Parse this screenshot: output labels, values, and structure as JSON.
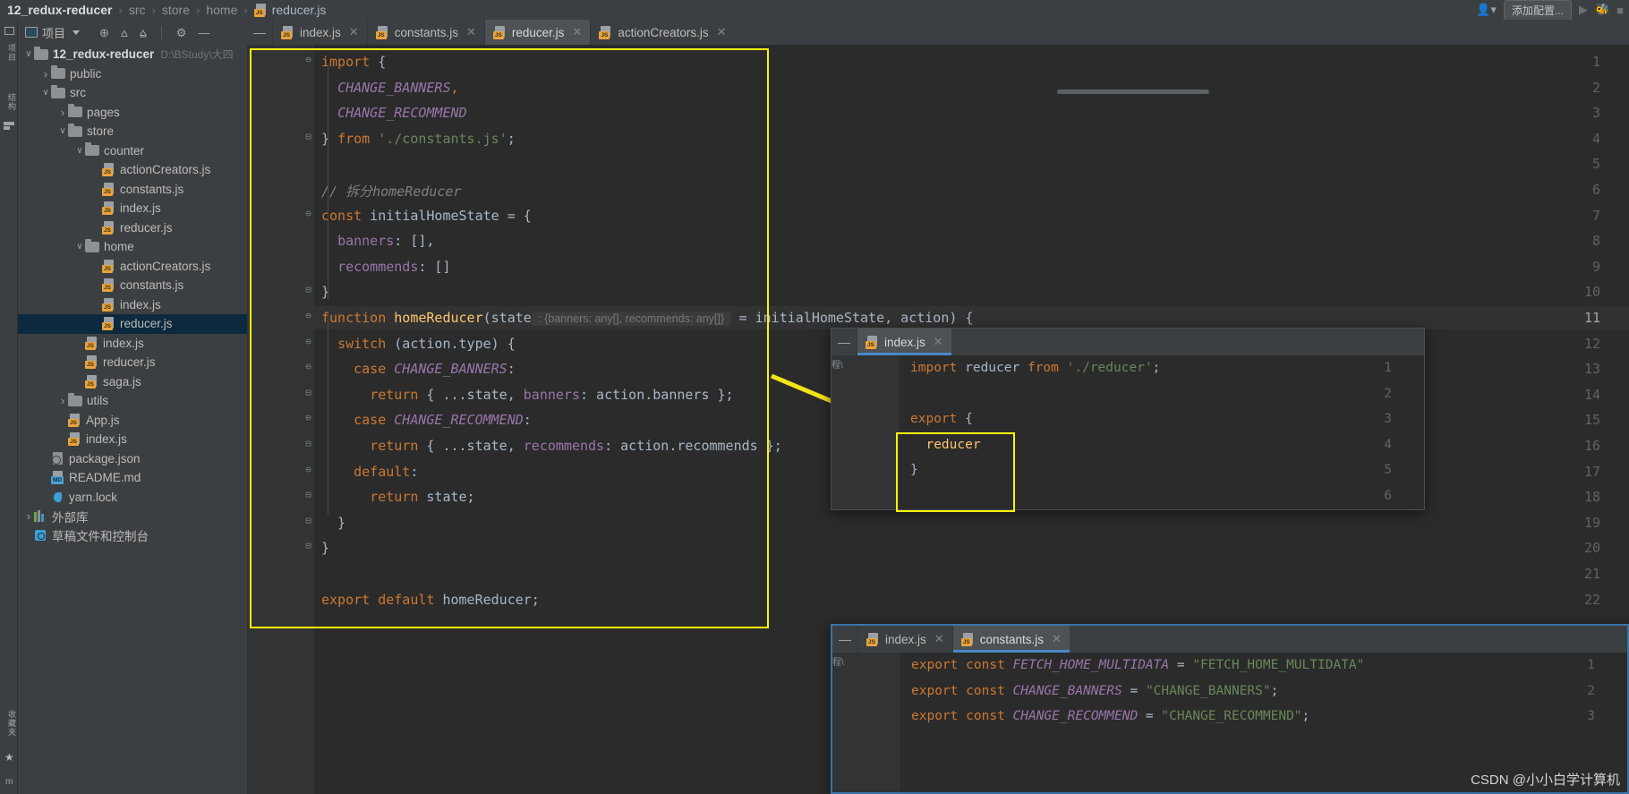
{
  "window": {
    "breadcrumb": [
      {
        "label": "12_redux-reducer",
        "style": "bold"
      },
      {
        "label": "src",
        "style": "dim"
      },
      {
        "label": "store",
        "style": "dim"
      },
      {
        "label": "home",
        "style": "dim"
      },
      {
        "label": "reducer.js",
        "style": "file"
      }
    ],
    "separator": "›",
    "add_config_label": "添加配置...",
    "run_icon": "run-icon",
    "debug_icon": "debug-icon",
    "stop_icon": "stop-icon",
    "user_icon": "user-icon"
  },
  "rail": {
    "top_label": "项目",
    "mid_label": "结构",
    "bottom_label": "收藏夹",
    "star_icon": "star-icon",
    "m_label": "m"
  },
  "project_panel": {
    "title": "项目",
    "icons": [
      {
        "name": "locate-icon",
        "glyph": "⊕"
      },
      {
        "name": "expand-all-icon",
        "glyph": "⩟"
      },
      {
        "name": "collapse-all-icon",
        "glyph": "⩠"
      },
      {
        "name": "settings-gear-icon",
        "glyph": "⚙"
      },
      {
        "name": "hide-panel-icon",
        "glyph": "—"
      }
    ]
  },
  "tree": [
    {
      "label": "12_redux-reducer",
      "path": "D:\\BStudy\\大四",
      "type": "folder",
      "indent": 0,
      "arrow": "down",
      "bold": true,
      "selected": false
    },
    {
      "label": "public",
      "type": "folder",
      "indent": 1,
      "arrow": "right",
      "selected": false
    },
    {
      "label": "src",
      "type": "folder",
      "indent": 1,
      "arrow": "down",
      "selected": false
    },
    {
      "label": "pages",
      "type": "folder",
      "indent": 2,
      "arrow": "right",
      "selected": false
    },
    {
      "label": "store",
      "type": "folder",
      "indent": 2,
      "arrow": "down",
      "selected": false
    },
    {
      "label": "counter",
      "type": "folder",
      "indent": 3,
      "arrow": "down",
      "selected": false
    },
    {
      "label": "actionCreators.js",
      "type": "js",
      "indent": 4,
      "arrow": "none",
      "selected": false
    },
    {
      "label": "constants.js",
      "type": "js",
      "indent": 4,
      "arrow": "none",
      "selected": false
    },
    {
      "label": "index.js",
      "type": "js",
      "indent": 4,
      "arrow": "none",
      "selected": false
    },
    {
      "label": "reducer.js",
      "type": "js",
      "indent": 4,
      "arrow": "none",
      "selected": false
    },
    {
      "label": "home",
      "type": "folder",
      "indent": 3,
      "arrow": "down",
      "selected": false
    },
    {
      "label": "actionCreators.js",
      "type": "js",
      "indent": 4,
      "arrow": "none",
      "selected": false
    },
    {
      "label": "constants.js",
      "type": "js",
      "indent": 4,
      "arrow": "none",
      "selected": false
    },
    {
      "label": "index.js",
      "type": "js",
      "indent": 4,
      "arrow": "none",
      "selected": false
    },
    {
      "label": "reducer.js",
      "type": "js",
      "indent": 4,
      "arrow": "none",
      "selected": true
    },
    {
      "label": "index.js",
      "type": "js",
      "indent": 3,
      "arrow": "none",
      "selected": false
    },
    {
      "label": "reducer.js",
      "type": "js",
      "indent": 3,
      "arrow": "none",
      "selected": false
    },
    {
      "label": "saga.js",
      "type": "js",
      "indent": 3,
      "arrow": "none",
      "selected": false
    },
    {
      "label": "utils",
      "type": "folder",
      "indent": 2,
      "arrow": "right",
      "selected": false
    },
    {
      "label": "App.js",
      "type": "js",
      "indent": 2,
      "arrow": "none",
      "selected": false
    },
    {
      "label": "index.js",
      "type": "js",
      "indent": 2,
      "arrow": "none",
      "selected": false
    },
    {
      "label": "package.json",
      "type": "pkg",
      "indent": 1,
      "arrow": "none",
      "selected": false
    },
    {
      "label": "README.md",
      "type": "md",
      "indent": 1,
      "arrow": "none",
      "selected": false
    },
    {
      "label": "yarn.lock",
      "type": "yarn",
      "indent": 1,
      "arrow": "none",
      "selected": false
    },
    {
      "label": "外部库",
      "type": "lib",
      "indent": 0,
      "arrow": "right",
      "selected": false
    },
    {
      "label": "草稿文件和控制台",
      "type": "scratch",
      "indent": 0,
      "arrow": "none",
      "selected": false
    }
  ],
  "tabs": [
    {
      "label": "index.js",
      "active": false,
      "closable": true
    },
    {
      "label": "constants.js",
      "active": false,
      "closable": true
    },
    {
      "label": "reducer.js",
      "active": true,
      "closable": true
    },
    {
      "label": "actionCreators.js",
      "active": false,
      "closable": true
    }
  ],
  "editor": {
    "file": "reducer.js",
    "lines": [
      {
        "n": 1,
        "fold": "⊖",
        "tokens": [
          {
            "t": "import",
            "c": "kw"
          },
          {
            "t": " {",
            "c": "pun"
          }
        ]
      },
      {
        "n": 2,
        "fold": "",
        "tokens": [
          {
            "t": "  ",
            "c": "pun"
          },
          {
            "t": "CHANGE_BANNERS",
            "c": "cst"
          },
          {
            "t": ",",
            "c": "kw"
          }
        ]
      },
      {
        "n": 3,
        "fold": "",
        "tokens": [
          {
            "t": "  ",
            "c": "pun"
          },
          {
            "t": "CHANGE_RECOMMEND",
            "c": "cst"
          }
        ]
      },
      {
        "n": 4,
        "fold": "⊟",
        "tokens": [
          {
            "t": "} ",
            "c": "pun"
          },
          {
            "t": "from",
            "c": "kw"
          },
          {
            "t": " ",
            "c": "pun"
          },
          {
            "t": "'./constants.js'",
            "c": "str"
          },
          {
            "t": ";",
            "c": "pun"
          }
        ]
      },
      {
        "n": 5,
        "fold": "",
        "tokens": []
      },
      {
        "n": 6,
        "fold": "",
        "tokens": [
          {
            "t": "// 拆分homeReducer",
            "c": "cmt"
          }
        ]
      },
      {
        "n": 7,
        "fold": "⊖",
        "tokens": [
          {
            "t": "const",
            "c": "kw"
          },
          {
            "t": " initialHomeState = {",
            "c": "id"
          }
        ]
      },
      {
        "n": 8,
        "fold": "",
        "tokens": [
          {
            "t": "  ",
            "c": "pun"
          },
          {
            "t": "banners",
            "c": "prop"
          },
          {
            "t": ": [],",
            "c": "id"
          }
        ]
      },
      {
        "n": 9,
        "fold": "",
        "tokens": [
          {
            "t": "  ",
            "c": "pun"
          },
          {
            "t": "recommends",
            "c": "prop"
          },
          {
            "t": ": []",
            "c": "id"
          }
        ]
      },
      {
        "n": 10,
        "fold": "⊟",
        "tokens": [
          {
            "t": "}",
            "c": "pun"
          }
        ]
      },
      {
        "n": 11,
        "fold": "⊖",
        "tokens": [
          {
            "t": "function",
            "c": "kw"
          },
          {
            "t": " ",
            "c": "pun"
          },
          {
            "t": "homeReducer",
            "c": "fn"
          },
          {
            "t": "(",
            "c": "pun"
          },
          {
            "t": "state",
            "c": "par"
          },
          {
            "t": "@HINT@",
            "c": "hint"
          },
          {
            "t": " = initialHomeState, action) {",
            "c": "id"
          }
        ]
      },
      {
        "n": 12,
        "fold": "⊖",
        "tokens": [
          {
            "t": "  ",
            "c": "pun"
          },
          {
            "t": "switch",
            "c": "kw"
          },
          {
            "t": " (action.type) {",
            "c": "id"
          }
        ]
      },
      {
        "n": 13,
        "fold": "⊖",
        "tokens": [
          {
            "t": "    ",
            "c": "pun"
          },
          {
            "t": "case",
            "c": "kw"
          },
          {
            "t": " ",
            "c": "pun"
          },
          {
            "t": "CHANGE_BANNERS",
            "c": "cst"
          },
          {
            "t": ":",
            "c": "id"
          }
        ]
      },
      {
        "n": 14,
        "fold": "⊟",
        "tokens": [
          {
            "t": "      ",
            "c": "pun"
          },
          {
            "t": "return",
            "c": "kw"
          },
          {
            "t": " { ...state, ",
            "c": "id"
          },
          {
            "t": "banners",
            "c": "prop"
          },
          {
            "t": ": action.banners };",
            "c": "id"
          }
        ]
      },
      {
        "n": 15,
        "fold": "⊖",
        "tokens": [
          {
            "t": "    ",
            "c": "pun"
          },
          {
            "t": "case",
            "c": "kw"
          },
          {
            "t": " ",
            "c": "pun"
          },
          {
            "t": "CHANGE_RECOMMEND",
            "c": "cst"
          },
          {
            "t": ":",
            "c": "id"
          }
        ]
      },
      {
        "n": 16,
        "fold": "⊟",
        "tokens": [
          {
            "t": "      ",
            "c": "pun"
          },
          {
            "t": "return",
            "c": "kw"
          },
          {
            "t": " { ...state, ",
            "c": "id"
          },
          {
            "t": "recommends",
            "c": "prop"
          },
          {
            "t": ": action.recommends };",
            "c": "id"
          }
        ]
      },
      {
        "n": 17,
        "fold": "⊖",
        "tokens": [
          {
            "t": "    ",
            "c": "pun"
          },
          {
            "t": "default",
            "c": "kw"
          },
          {
            "t": ":",
            "c": "id"
          }
        ]
      },
      {
        "n": 18,
        "fold": "⊟",
        "tokens": [
          {
            "t": "      ",
            "c": "pun"
          },
          {
            "t": "return",
            "c": "kw"
          },
          {
            "t": " state;",
            "c": "id"
          }
        ]
      },
      {
        "n": 19,
        "fold": "⊟",
        "tokens": [
          {
            "t": "  }",
            "c": "pun"
          }
        ]
      },
      {
        "n": 20,
        "fold": "⊟",
        "tokens": [
          {
            "t": "}",
            "c": "pun"
          }
        ]
      },
      {
        "n": 21,
        "fold": "",
        "tokens": []
      },
      {
        "n": 22,
        "fold": "",
        "tokens": [
          {
            "t": "export",
            "c": "kw"
          },
          {
            "t": " ",
            "c": "pun"
          },
          {
            "t": "default",
            "c": "kw"
          },
          {
            "t": " homeReducer;",
            "c": "id"
          }
        ]
      }
    ],
    "inlay_hint": ": {banners: any[], recommends: any[]}",
    "current_line": 11
  },
  "panel_index": {
    "tabs": [
      {
        "label": "index.js",
        "active": true,
        "closable": true
      }
    ],
    "collapse_icon": "collapse-icon",
    "vertical_label": "程\\",
    "lines": [
      {
        "n": 1,
        "tokens": [
          {
            "t": "import",
            "c": "kw"
          },
          {
            "t": " reducer ",
            "c": "id"
          },
          {
            "t": "from",
            "c": "kw"
          },
          {
            "t": " ",
            "c": "pun"
          },
          {
            "t": "'./reducer'",
            "c": "str"
          },
          {
            "t": ";",
            "c": "pun"
          }
        ]
      },
      {
        "n": 2,
        "tokens": []
      },
      {
        "n": 3,
        "tokens": [
          {
            "t": "export",
            "c": "kw"
          },
          {
            "t": " {",
            "c": "pun"
          }
        ]
      },
      {
        "n": 4,
        "tokens": [
          {
            "t": "  reducer",
            "c": "fn"
          }
        ]
      },
      {
        "n": 5,
        "tokens": [
          {
            "t": "}",
            "c": "pun"
          }
        ]
      },
      {
        "n": 6,
        "tokens": []
      }
    ]
  },
  "panel_constants": {
    "tabs": [
      {
        "label": "index.js",
        "active": false,
        "closable": true
      },
      {
        "label": "constants.js",
        "active": true,
        "closable": true
      }
    ],
    "collapse_icon": "collapse-icon",
    "vertical_label": "程\\",
    "lines": [
      {
        "n": 1,
        "tokens": [
          {
            "t": "export",
            "c": "kw"
          },
          {
            "t": " ",
            "c": "pun"
          },
          {
            "t": "const",
            "c": "kw"
          },
          {
            "t": " ",
            "c": "pun"
          },
          {
            "t": "FETCH_HOME_MULTIDATA",
            "c": "cst"
          },
          {
            "t": " = ",
            "c": "id"
          },
          {
            "t": "\"FETCH_HOME_MULTIDATA\"",
            "c": "str"
          }
        ]
      },
      {
        "n": 2,
        "tokens": [
          {
            "t": "export",
            "c": "kw"
          },
          {
            "t": " ",
            "c": "pun"
          },
          {
            "t": "const",
            "c": "kw"
          },
          {
            "t": " ",
            "c": "pun"
          },
          {
            "t": "CHANGE_BANNERS",
            "c": "cst"
          },
          {
            "t": " = ",
            "c": "id"
          },
          {
            "t": "\"CHANGE_BANNERS\"",
            "c": "str"
          },
          {
            "t": ";",
            "c": "pun"
          }
        ]
      },
      {
        "n": 3,
        "tokens": [
          {
            "t": "export",
            "c": "kw"
          },
          {
            "t": " ",
            "c": "pun"
          },
          {
            "t": "const",
            "c": "kw"
          },
          {
            "t": " ",
            "c": "pun"
          },
          {
            "t": "CHANGE_RECOMMEND",
            "c": "cst"
          },
          {
            "t": " = ",
            "c": "id"
          },
          {
            "t": "\"CHANGE_RECOMMEND\"",
            "c": "str"
          },
          {
            "t": ";",
            "c": "pun"
          }
        ]
      }
    ]
  },
  "annotations": {
    "highlight_color": "#fdf500",
    "arrow_color": "#f2e516",
    "watermark": "CSDN @小小白学计算机"
  }
}
